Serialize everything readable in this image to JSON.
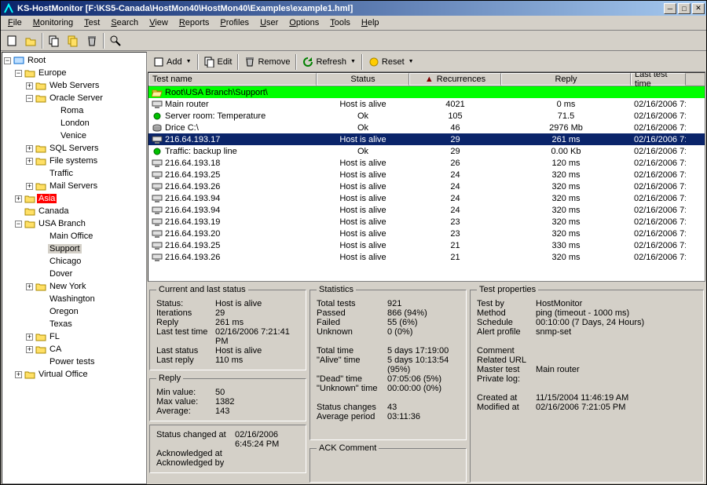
{
  "window": {
    "title": "KS-HostMonitor  [F:\\KS5-Canada\\HostMon40\\HostMon40\\Examples\\example1.hml]"
  },
  "menu": [
    "File",
    "Monitoring",
    "Test",
    "Search",
    "View",
    "Reports",
    "Profiles",
    "User",
    "Options",
    "Tools",
    "Help"
  ],
  "toolbar_left": {
    "new": "new-file-icon",
    "open": "open-icon",
    "save": "save-icon",
    "copy": "copy-icon",
    "trash": "trash-icon",
    "find": "search-icon"
  },
  "toolbar_right": {
    "add": "Add",
    "edit": "Edit",
    "remove": "Remove",
    "refresh": "Refresh",
    "reset": "Reset"
  },
  "tree": [
    {
      "depth": 0,
      "toggle": "-",
      "icon": "root",
      "label": "Root"
    },
    {
      "depth": 1,
      "toggle": "-",
      "icon": "folder",
      "label": "Europe"
    },
    {
      "depth": 2,
      "toggle": "+",
      "icon": "folder",
      "label": "Web Servers"
    },
    {
      "depth": 2,
      "toggle": "-",
      "icon": "folder",
      "label": "Oracle Server"
    },
    {
      "depth": 3,
      "toggle": "",
      "icon": "leaf",
      "label": "Roma"
    },
    {
      "depth": 3,
      "toggle": "",
      "icon": "leaf",
      "label": "London"
    },
    {
      "depth": 3,
      "toggle": "",
      "icon": "leaf",
      "label": "Venice"
    },
    {
      "depth": 2,
      "toggle": "+",
      "icon": "folder",
      "label": "SQL Servers"
    },
    {
      "depth": 2,
      "toggle": "+",
      "icon": "folder",
      "label": "File systems"
    },
    {
      "depth": 2,
      "toggle": "",
      "icon": "leaf",
      "label": "Traffic"
    },
    {
      "depth": 2,
      "toggle": "+",
      "icon": "folder",
      "label": "Mail Servers"
    },
    {
      "depth": 1,
      "toggle": "+",
      "icon": "folder",
      "label": "Asia",
      "red": true
    },
    {
      "depth": 1,
      "toggle": "",
      "icon": "folder",
      "label": "Canada"
    },
    {
      "depth": 1,
      "toggle": "-",
      "icon": "folder",
      "label": "USA Branch"
    },
    {
      "depth": 2,
      "toggle": "",
      "icon": "leaf",
      "label": "Main Office"
    },
    {
      "depth": 2,
      "toggle": "",
      "icon": "leaf",
      "label": "Support",
      "selected": true
    },
    {
      "depth": 2,
      "toggle": "",
      "icon": "leaf",
      "label": "Chicago"
    },
    {
      "depth": 2,
      "toggle": "",
      "icon": "leaf",
      "label": "Dover"
    },
    {
      "depth": 2,
      "toggle": "+",
      "icon": "folder",
      "label": "New York"
    },
    {
      "depth": 2,
      "toggle": "",
      "icon": "leaf",
      "label": "Washington"
    },
    {
      "depth": 2,
      "toggle": "",
      "icon": "leaf",
      "label": "Oregon"
    },
    {
      "depth": 2,
      "toggle": "",
      "icon": "leaf",
      "label": "Texas"
    },
    {
      "depth": 2,
      "toggle": "+",
      "icon": "folder",
      "label": "FL"
    },
    {
      "depth": 2,
      "toggle": "+",
      "icon": "folder",
      "label": "CA"
    },
    {
      "depth": 2,
      "toggle": "",
      "icon": "leaf",
      "label": "Power tests"
    },
    {
      "depth": 1,
      "toggle": "+",
      "icon": "folder",
      "label": "Virtual Office"
    }
  ],
  "columns": [
    "Test name",
    "Status",
    "Recurrences",
    "Reply",
    "Last test time"
  ],
  "rows": [
    {
      "icon": "folder-open",
      "name": "Root\\USA Branch\\Support\\",
      "status": "",
      "recur": "",
      "reply": "",
      "time": "",
      "green": true
    },
    {
      "icon": "host",
      "name": "Main router",
      "status": "Host is alive",
      "recur": "4021",
      "reply": "0 ms",
      "time": "02/16/2006 7:"
    },
    {
      "icon": "temp",
      "name": "Server room: Temperature",
      "status": "Ok",
      "recur": "105",
      "reply": "71.5",
      "time": "02/16/2006 7:"
    },
    {
      "icon": "disk",
      "name": "Drice C:\\",
      "status": "Ok",
      "recur": "46",
      "reply": "2976 Mb",
      "time": "02/16/2006 7:"
    },
    {
      "icon": "host",
      "name": "216.64.193.17",
      "status": "Host is alive",
      "recur": "29",
      "reply": "261 ms",
      "time": "02/16/2006 7:",
      "sel": true
    },
    {
      "icon": "traffic",
      "name": "Traffic: backup line",
      "status": "Ok",
      "recur": "29",
      "reply": "0.00 Kb",
      "time": "02/16/2006 7:"
    },
    {
      "icon": "host",
      "name": "216.64.193.18",
      "status": "Host is alive",
      "recur": "26",
      "reply": "120 ms",
      "time": "02/16/2006 7:"
    },
    {
      "icon": "host",
      "name": "216.64.193.25",
      "status": "Host is alive",
      "recur": "24",
      "reply": "320 ms",
      "time": "02/16/2006 7:"
    },
    {
      "icon": "host",
      "name": "216.64.193.26",
      "status": "Host is alive",
      "recur": "24",
      "reply": "320 ms",
      "time": "02/16/2006 7:"
    },
    {
      "icon": "host",
      "name": "216.64.193.94",
      "status": "Host is alive",
      "recur": "24",
      "reply": "320 ms",
      "time": "02/16/2006 7:"
    },
    {
      "icon": "host",
      "name": "216.64.193.94",
      "status": "Host is alive",
      "recur": "24",
      "reply": "320 ms",
      "time": "02/16/2006 7:"
    },
    {
      "icon": "host",
      "name": "216.64.193.19",
      "status": "Host is alive",
      "recur": "23",
      "reply": "320 ms",
      "time": "02/16/2006 7:"
    },
    {
      "icon": "host",
      "name": "216.64.193.20",
      "status": "Host is alive",
      "recur": "23",
      "reply": "320 ms",
      "time": "02/16/2006 7:"
    },
    {
      "icon": "host",
      "name": "216.64.193.25",
      "status": "Host is alive",
      "recur": "21",
      "reply": "330 ms",
      "time": "02/16/2006 7:"
    },
    {
      "icon": "host",
      "name": "216.64.193.26",
      "status": "Host is alive",
      "recur": "21",
      "reply": "320 ms",
      "time": "02/16/2006 7:"
    }
  ],
  "status_panel": {
    "title": "Current and last status",
    "rows": [
      [
        "Status:",
        "Host is alive"
      ],
      [
        "Iterations",
        "29"
      ],
      [
        "Reply",
        "261 ms"
      ],
      [
        "Last test time",
        "02/16/2006 7:21:41 PM"
      ],
      [
        "Last status",
        "Host is alive"
      ],
      [
        "Last reply",
        "110 ms"
      ]
    ]
  },
  "reply_panel": {
    "title": "Reply",
    "rows": [
      [
        "Min value:",
        "50"
      ],
      [
        "Max value:",
        "1382"
      ],
      [
        "Average:",
        "143"
      ]
    ]
  },
  "ack_panel": {
    "title": "",
    "rows": [
      [
        "Status changed at",
        "02/16/2006 6:45:24 PM"
      ],
      [
        "Acknowledged at",
        ""
      ],
      [
        "Acknowledged by",
        ""
      ]
    ]
  },
  "stats_panel": {
    "title": "Statistics",
    "rows": [
      [
        "Total tests",
        "921"
      ],
      [
        "Passed",
        "866 (94%)"
      ],
      [
        "Failed",
        "55 (6%)"
      ],
      [
        "Unknown",
        "0 (0%)"
      ],
      [
        "",
        ""
      ],
      [
        "Total time",
        "5 days 17:19:00"
      ],
      [
        "\"Alive\" time",
        "5 days 10:13:54 (95%)"
      ],
      [
        "\"Dead\" time",
        "07:05:06 (5%)"
      ],
      [
        "\"Unknown\" time",
        "00:00:00 (0%)"
      ],
      [
        "",
        ""
      ],
      [
        "Status changes",
        "43"
      ],
      [
        "Average period",
        "03:11:36"
      ]
    ]
  },
  "ack_comment_title": "ACK Comment",
  "props_panel": {
    "title": "Test properties",
    "rows": [
      [
        "Test by",
        "HostMonitor"
      ],
      [
        "Method",
        "ping  (timeout - 1000 ms)"
      ],
      [
        "Schedule",
        "00:10:00 (7 Days, 24 Hours)"
      ],
      [
        "Alert profile",
        "snmp-set"
      ],
      [
        "",
        ""
      ],
      [
        "Comment",
        ""
      ],
      [
        "Related URL",
        ""
      ],
      [
        "Master test",
        "Main router"
      ],
      [
        "Private log:",
        ""
      ],
      [
        "",
        ""
      ],
      [
        "Created at",
        "11/15/2004 11:46:19 AM"
      ],
      [
        "Modified at",
        "02/16/2006 7:21:05 PM"
      ]
    ]
  }
}
